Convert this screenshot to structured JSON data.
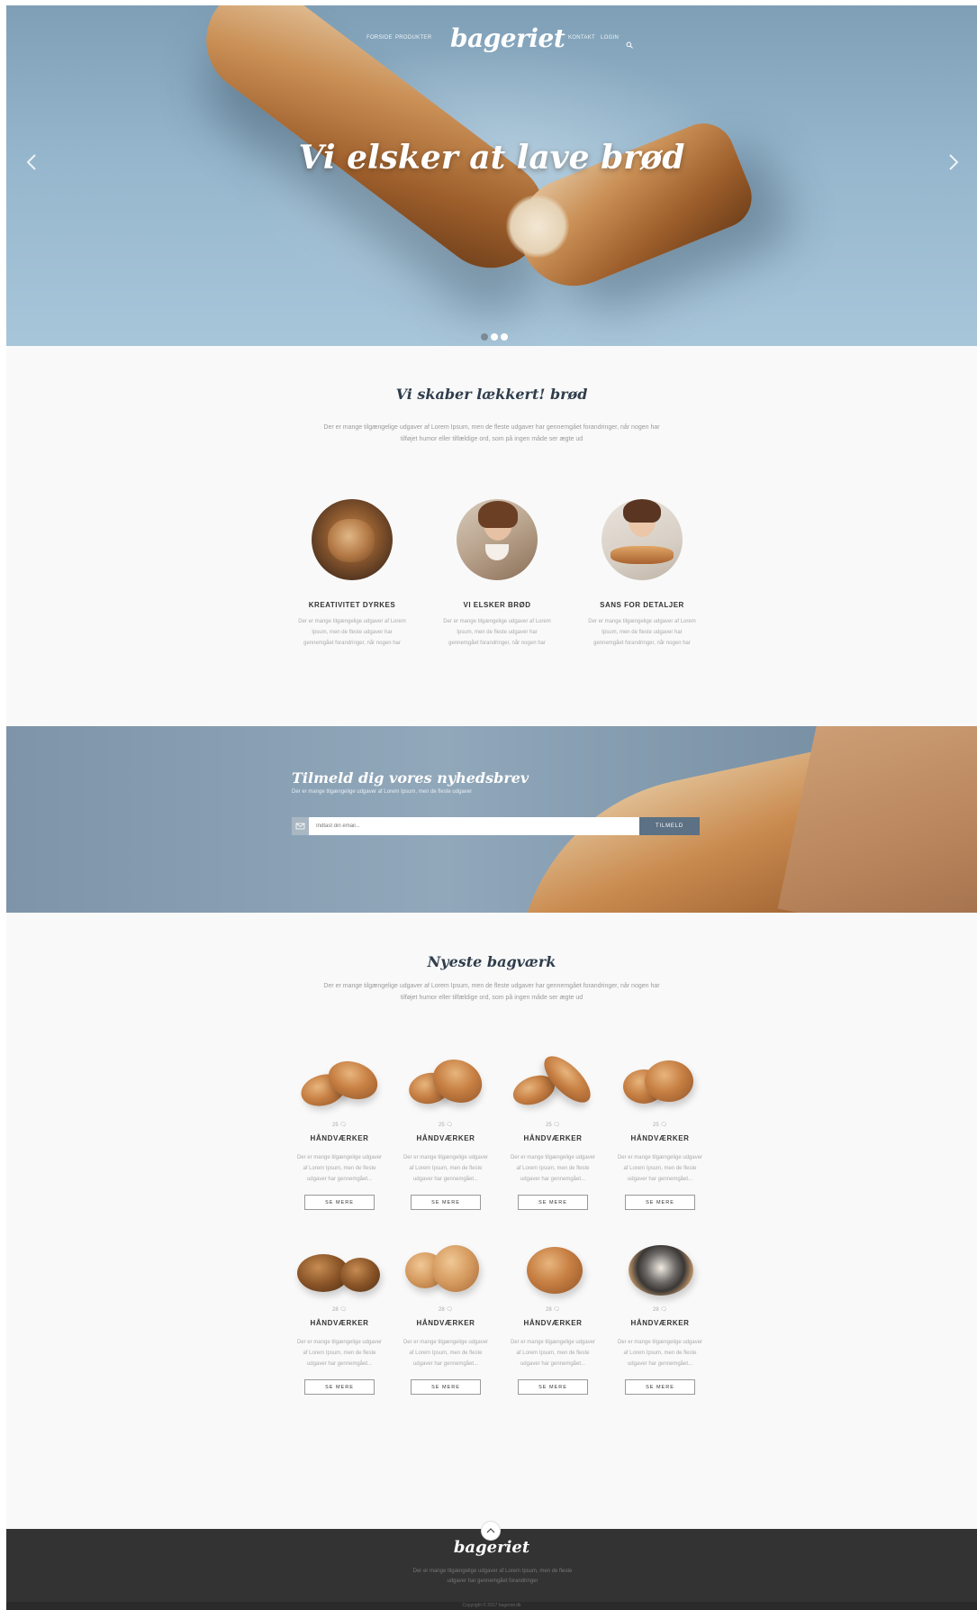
{
  "nav": {
    "left": [
      "FORSIDE",
      "PRODUKTER"
    ],
    "brand": "bageriet",
    "right": [
      "KONTAKT",
      "LOGIN"
    ],
    "search_icon": "search-icon"
  },
  "hero": {
    "title": "Vi elsker at lave brød",
    "slides": 3,
    "active_slide": 1,
    "prev_icon": "chevron-left-icon",
    "next_icon": "chevron-right-icon"
  },
  "about": {
    "title": "Vi skaber lækkert! brød",
    "lead": "Der er mange tilgængelige udgaver af Lorem Ipsum, men de fleste udgaver har gennemgået forandringer, når nogen har tilføjet humor eller tilfældige ord, som på ingen måde ser ægte ud",
    "features": [
      {
        "title": "KREATIVITET DYRKES",
        "text": "Der er mange tilgængelige udgaver af Lorem Ipsum, men de fleste udgaver har gennemgået forandringer, når nogen har"
      },
      {
        "title": "VI ELSKER BRØD",
        "text": "Der er mange tilgængelige udgaver af Lorem Ipsum, men de fleste udgaver har gennemgået forandringer, når nogen har"
      },
      {
        "title": "SANS FOR DETALJER",
        "text": "Der er mange tilgængelige udgaver af Lorem Ipsum, men de fleste udgaver har gennemgået forandringer, når nogen har"
      }
    ]
  },
  "newsletter": {
    "title": "Tilmeld dig vores nyhedsbrev",
    "subtitle": "Der er mange tilgængelige udgaver af Lorem Ipsum, men de fleste udgaver",
    "placeholder": "Indtast din email...",
    "button": "TILMELD",
    "mail_icon": "envelope-icon"
  },
  "products": {
    "title": "Nyeste bagværk",
    "lead": "Der er mange tilgængelige udgaver af Lorem Ipsum, men de fleste udgaver har gennemgået forandringer, når nogen har tilføjet humor eller tilfældige ord, som på ingen måde ser ægte ud",
    "items": [
      {
        "meta": "25 🗨",
        "title": "HÅNDVÆRKER",
        "text": "Der er mange tilgængelige udgaver af Lorem Ipsum, men de fleste udgaver har gennemgået...",
        "button": "SE MERE"
      },
      {
        "meta": "25 🗨",
        "title": "HÅNDVÆRKER",
        "text": "Der er mange tilgængelige udgaver af Lorem Ipsum, men de fleste udgaver har gennemgået...",
        "button": "SE MERE"
      },
      {
        "meta": "25 🗨",
        "title": "HÅNDVÆRKER",
        "text": "Der er mange tilgængelige udgaver af Lorem Ipsum, men de fleste udgaver har gennemgået...",
        "button": "SE MERE"
      },
      {
        "meta": "25 🗨",
        "title": "HÅNDVÆRKER",
        "text": "Der er mange tilgængelige udgaver af Lorem Ipsum, men de fleste udgaver har gennemgået...",
        "button": "SE MERE"
      },
      {
        "meta": "28 🗨",
        "title": "HÅNDVÆRKER",
        "text": "Der er mange tilgængelige udgaver af Lorem Ipsum, men de fleste udgaver har gennemgået...",
        "button": "SE MERE"
      },
      {
        "meta": "28 🗨",
        "title": "HÅNDVÆRKER",
        "text": "Der er mange tilgængelige udgaver af Lorem Ipsum, men de fleste udgaver har gennemgået...",
        "button": "SE MERE"
      },
      {
        "meta": "28 🗨",
        "title": "HÅNDVÆRKER",
        "text": "Der er mange tilgængelige udgaver af Lorem Ipsum, men de fleste udgaver har gennemgået...",
        "button": "SE MERE"
      },
      {
        "meta": "28 🗨",
        "title": "HÅNDVÆRKER",
        "text": "Der er mange tilgængelige udgaver af Lorem Ipsum, men de fleste udgaver har gennemgået...",
        "button": "SE MERE"
      }
    ]
  },
  "footer": {
    "brand": "bageriet",
    "text": "Der er mange tilgængelige udgaver af Lorem Ipsum, men de fleste udgaver har gennemgået forandringer",
    "copyright": "Copyright © 2017 bageriet.dk",
    "to_top_icon": "chevron-up-icon"
  },
  "colors": {
    "hero_blue": "#95b6cc",
    "heading_navy": "#2f3d4c",
    "subscribe_button": "#5c7184",
    "footer_dark": "#333333"
  }
}
